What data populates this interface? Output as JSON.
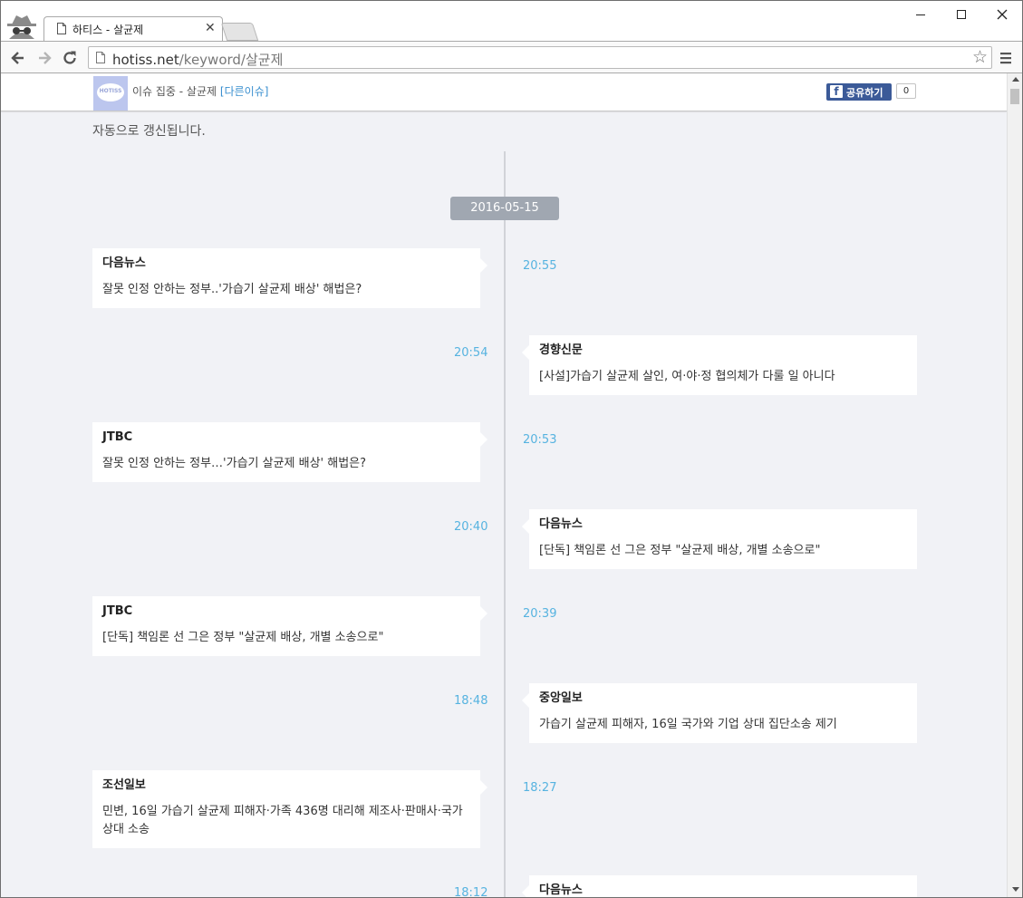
{
  "browser": {
    "tab_title": "하티스 - 살균제",
    "url_host": "hotiss.net",
    "url_path": "/keyword/살균제"
  },
  "header": {
    "logo_text": "HOTISS",
    "issue_label": "이슈 집중 - 살균제",
    "other_issue_link": "[다른이슈]",
    "share_label": "공유하기",
    "share_count": "0"
  },
  "notice": "자동으로 갱신됩니다.",
  "date": "2016-05-15",
  "items": [
    {
      "source": "다음뉴스",
      "headline": "잘못 인정 안하는 정부..'가습기 살균제 배상' 해법은?",
      "time": "20:55"
    },
    {
      "source": "경향신문",
      "headline": "[사설]가습기 살균제 살인, 여·야·정 협의체가 다룰 일 아니다",
      "time": "20:54"
    },
    {
      "source": "JTBC",
      "headline": "잘못 인정 안하는 정부…'가습기 살균제 배상' 해법은?",
      "time": "20:53"
    },
    {
      "source": "다음뉴스",
      "headline": "[단독] 책임론 선 그은 정부 \"살균제 배상, 개별 소송으로\"",
      "time": "20:40"
    },
    {
      "source": "JTBC",
      "headline": "[단독] 책임론 선 그은 정부 \"살균제 배상, 개별 소송으로\"",
      "time": "20:39"
    },
    {
      "source": "중앙일보",
      "headline": "가습기 살균제 피해자, 16일 국가와 기업 상대 집단소송 제기",
      "time": "18:48"
    },
    {
      "source": "조선일보",
      "headline": "민변, 16일 가습기 살균제 피해자·가족 436명 대리해 제조사·판매사·국가 상대 소송",
      "time": "18:27"
    },
    {
      "source": "다음뉴스",
      "headline": "",
      "time": "18:12"
    }
  ]
}
